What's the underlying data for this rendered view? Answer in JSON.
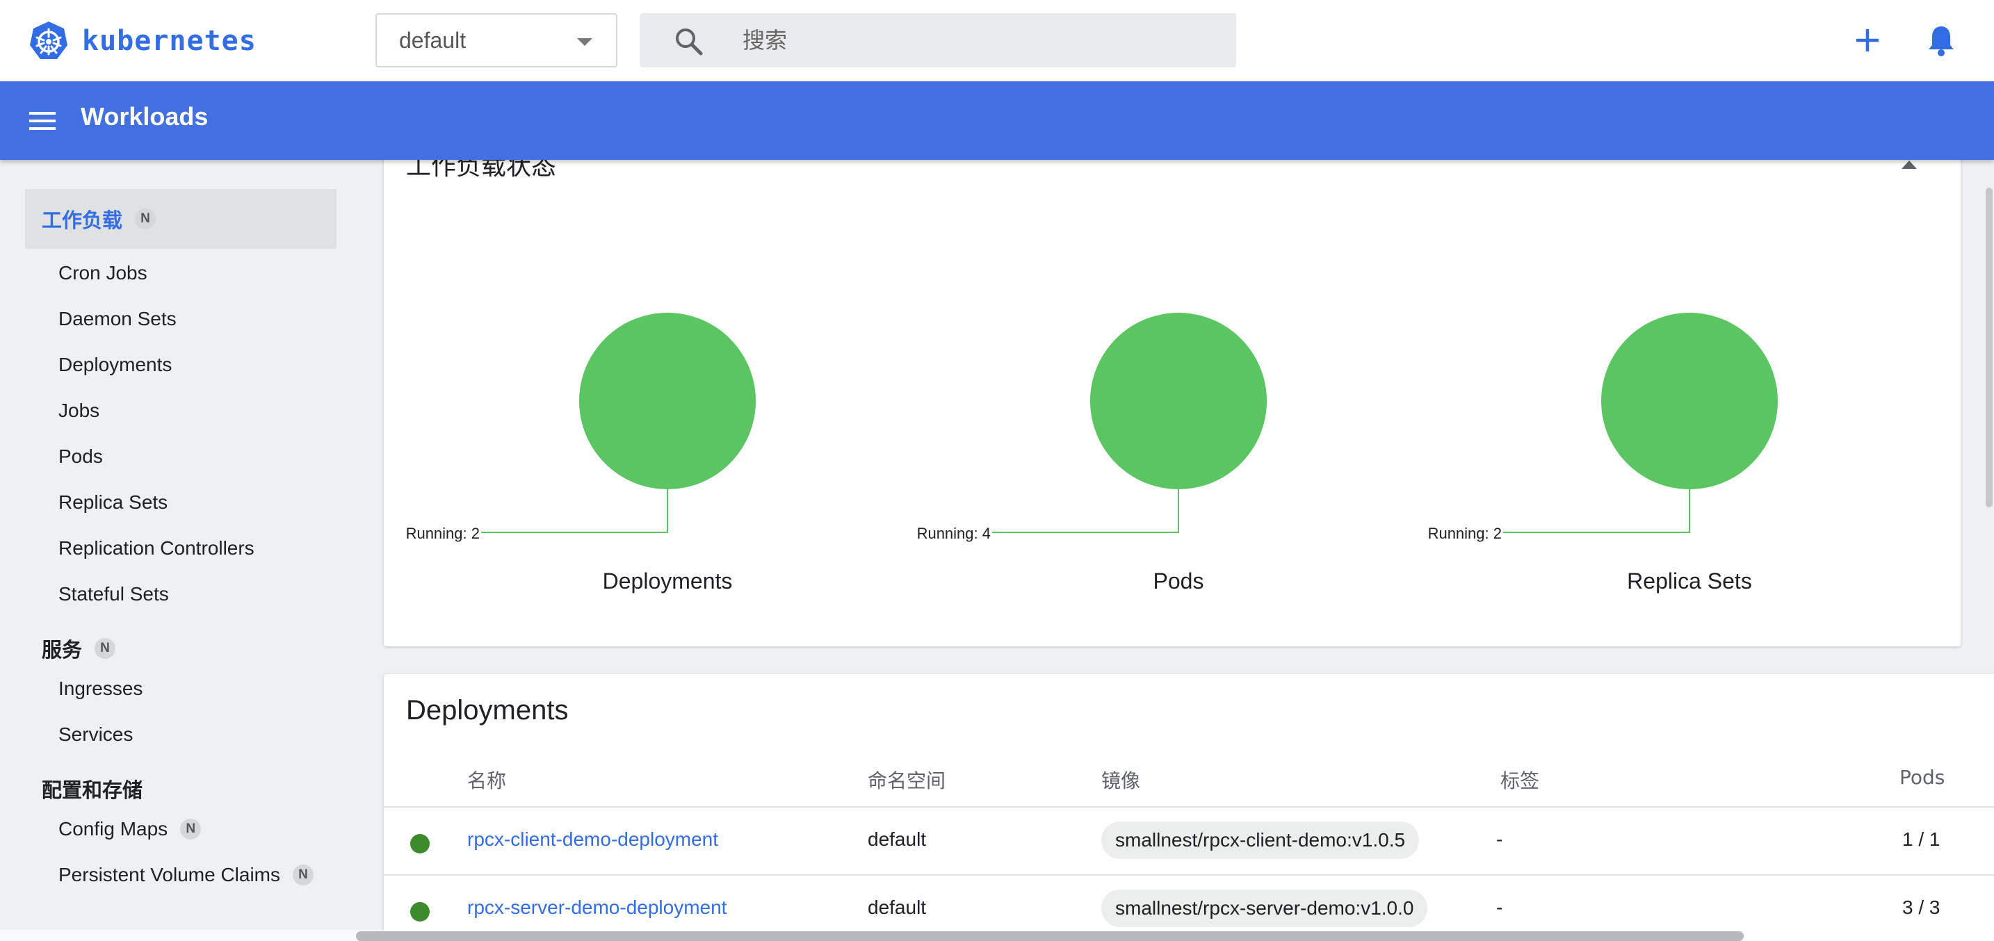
{
  "topbar": {
    "brand_name": "kubernetes",
    "namespace": "default",
    "search_placeholder": "搜索"
  },
  "appbar": {
    "title": "Workloads"
  },
  "sidebar": {
    "sections": [
      {
        "label": "工作负载",
        "badge": "N",
        "active": true
      },
      {
        "label": "服务",
        "badge": "N"
      },
      {
        "label": "配置和存储"
      }
    ],
    "workload_items": [
      "Cron Jobs",
      "Daemon Sets",
      "Deployments",
      "Jobs",
      "Pods",
      "Replica Sets",
      "Replication Controllers",
      "Stateful Sets"
    ],
    "service_items": [
      "Ingresses",
      "Services"
    ],
    "config_items": [
      {
        "label": "Config Maps",
        "badge": "N"
      },
      {
        "label": "Persistent Volume Claims",
        "badge": "N"
      }
    ]
  },
  "status_card": {
    "title": "工作负载状态",
    "charts": [
      {
        "title": "Deployments",
        "label": "Running: 2",
        "running": 2
      },
      {
        "title": "Pods",
        "label": "Running: 4",
        "running": 4
      },
      {
        "title": "Replica Sets",
        "label": "Running: 2",
        "running": 2
      }
    ]
  },
  "deployments": {
    "title": "Deployments",
    "columns": [
      "名称",
      "命名空间",
      "镜像",
      "标签",
      "Pods"
    ],
    "rows": [
      {
        "name": "rpcx-client-demo-deployment",
        "namespace": "default",
        "image": "smallnest/rpcx-client-demo:v1.0.5",
        "labels": "-",
        "pods": "1 / 1"
      },
      {
        "name": "rpcx-server-demo-deployment",
        "namespace": "default",
        "image": "smallnest/rpcx-server-demo:v1.0.0",
        "labels": "-",
        "pods": "3 / 3"
      }
    ]
  },
  "colors": {
    "brand": "#326de6",
    "header": "#4270e0",
    "running": "#5ac561",
    "status_ok": "#3b8b2d"
  }
}
